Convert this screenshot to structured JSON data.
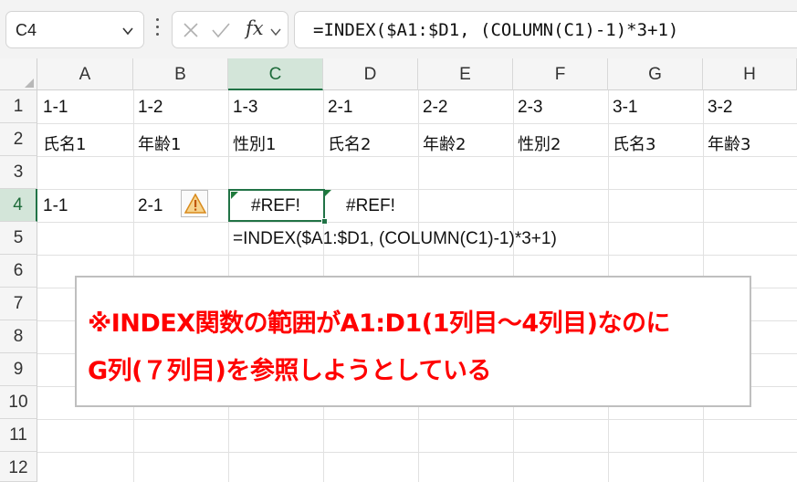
{
  "formula_bar": {
    "name_box": "C4",
    "fx_label": "fx",
    "formula": "=INDEX($A1:$D1, (COLUMN(C1)-1)*3+1)"
  },
  "sheet": {
    "column_headers": [
      "A",
      "B",
      "C",
      "D",
      "E",
      "F",
      "G",
      "H"
    ],
    "row_headers": [
      "1",
      "2",
      "3",
      "4",
      "5",
      "6",
      "7",
      "8",
      "9",
      "10",
      "11",
      "12"
    ],
    "selected_cell": "C4",
    "row1": [
      "1-1",
      "1-2",
      "1-3",
      "2-1",
      "2-2",
      "2-3",
      "3-1",
      "3-2"
    ],
    "row2": [
      "氏名1",
      "年齢1",
      "性別1",
      "氏名2",
      "年齢2",
      "性別2",
      "氏名3",
      "年齢3"
    ],
    "row4": {
      "a": "1-1",
      "b": "2-1",
      "c": "#REF!",
      "d": "#REF!"
    },
    "row5_c": "=INDEX($A1:$D1, (COLUMN(C1)-1)*3+1)"
  },
  "callout": {
    "line1": "※INDEX関数の範囲がA1:D1(1列目～4列目)なのに",
    "line2": "G列(７列目)を参照しようとしている"
  },
  "colors": {
    "accent": "#217346",
    "error_text": "#ff0000",
    "warning": "#e8a33d"
  },
  "icons": {
    "name_box_dropdown": "chevron-down-icon",
    "more": "more-vertical-icon",
    "cancel": "cancel-x-icon",
    "enter": "check-icon",
    "insert_function": "fx-icon",
    "formula_expand": "chevron-down-icon",
    "error_indicator": "warning-icon"
  }
}
